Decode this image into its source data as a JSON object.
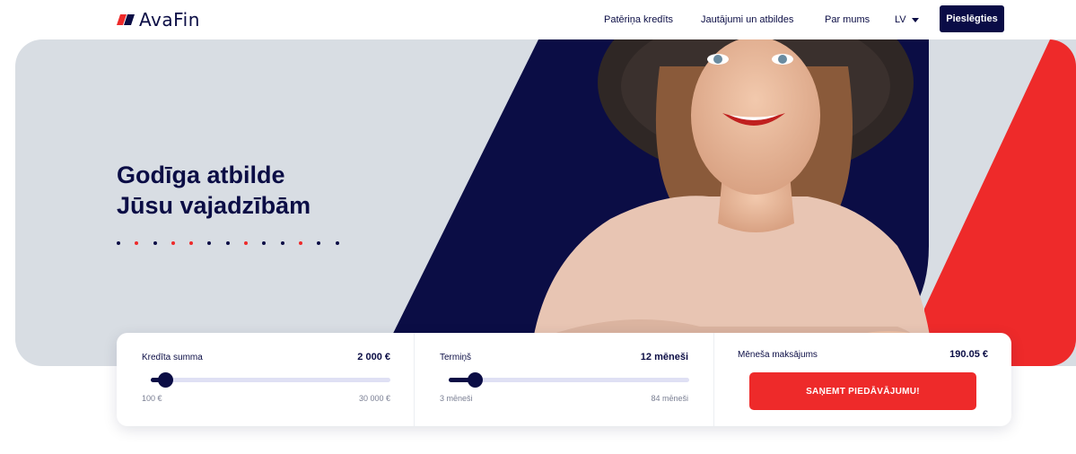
{
  "brand": {
    "name": "AvaFin"
  },
  "nav": {
    "items": [
      "Patēriņa kredīts",
      "Jautājumi un atbildes",
      "Par mums"
    ],
    "language": "LV",
    "login_label": "Pieslēgties"
  },
  "hero": {
    "headline_line1": "Godīga atbilde",
    "headline_line2": "Jūsu vajadzībām",
    "dot_colors": [
      "#0b0d45",
      "#ee2a2a",
      "#0b0d45",
      "#ee2a2a",
      "#ee2a2a",
      "#0b0d45",
      "#0b0d45",
      "#ee2a2a",
      "#0b0d45",
      "#0b0d45",
      "#ee2a2a",
      "#0b0d45",
      "#0b0d45"
    ],
    "image": "smiling woman in wide-brimmed hat and knit sweater"
  },
  "calculator": {
    "amount": {
      "label": "Kredīta summa",
      "value": "2 000 €",
      "min": "100 €",
      "max": "30 000 €",
      "level": 0.06
    },
    "term": {
      "label": "Termiņš",
      "value": "12 mēneši",
      "min": "3 mēneši",
      "max": "84 mēneši",
      "level": 0.11
    },
    "payment": {
      "label": "Mēneša maksājums",
      "value": "190.05 €"
    },
    "cta_label": "SAŅEMT PIEDĀVĀJUMU!"
  },
  "colors": {
    "navy": "#0b0d45",
    "red": "#ee2a2a",
    "grey": "#d8dde3"
  }
}
